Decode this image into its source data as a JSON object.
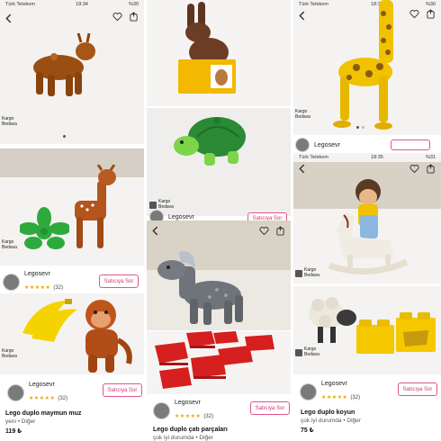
{
  "status_bar": {
    "carrier": "Türk Telekom",
    "time_left": "18:34",
    "battery": "%30",
    "time_right": "18:35",
    "battery_right": "%31"
  },
  "badge": {
    "line1": "Kargo",
    "line2": "Bedava"
  },
  "sellers": {
    "left": {
      "name": "Legosevr",
      "stars": "★★★★★",
      "count": "(32)",
      "ask": "Satıcıya Sor"
    },
    "middle_top": {
      "name": "Legosevr",
      "ask": "Satıcıya Sor"
    },
    "middle_bottom": {
      "name": "Legosevr",
      "stars": "★★★★★",
      "count": "(32)",
      "ask": "Satıcıya Sor"
    },
    "right_top": {
      "name": "Legosevr"
    },
    "right_bottom": {
      "name": "Legosevr",
      "stars": "★★★★★",
      "count": "(32)",
      "ask": "Satıcıya Sor"
    }
  },
  "products": {
    "left": {
      "title": "Lego duplo maymun muz",
      "condition": "yeni • Diğer",
      "price": "119 ₺"
    },
    "middle": {
      "title": "Lego duplo çatı parçaları",
      "condition": "çok iyi durumda • Diğer"
    },
    "right": {
      "title": "Lego duplo koyun",
      "condition": "çok iyi durumda • Diğer",
      "price": "75 ₺"
    }
  },
  "icons": [
    "back-arrow-icon",
    "heart-icon",
    "share-icon",
    "cargo-box-icon"
  ],
  "colors": {
    "accent": "#d1346f",
    "star": "#f0a500",
    "duplo_green": "#2eaa3c",
    "duplo_yellow": "#f5c800"
  }
}
